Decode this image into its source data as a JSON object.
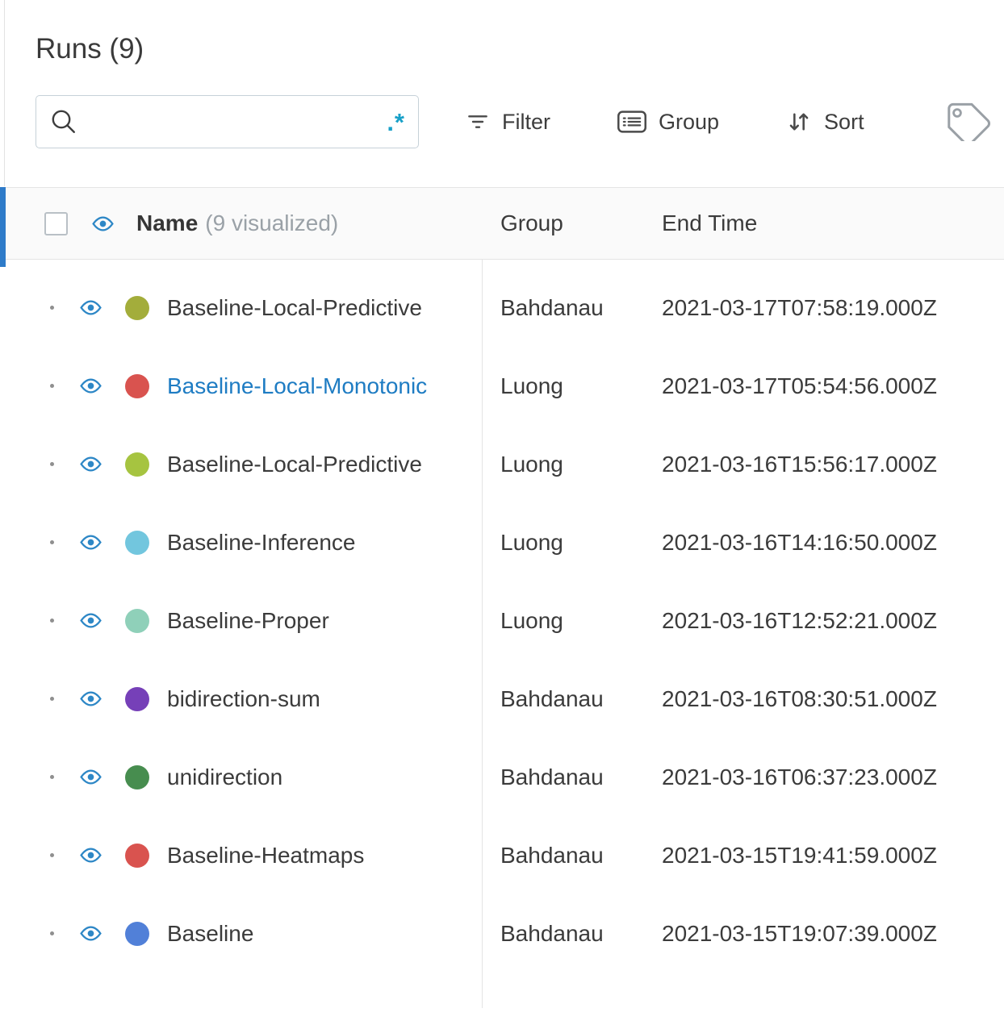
{
  "panel": {
    "title": "Runs (9)"
  },
  "search": {
    "placeholder": "",
    "value": "",
    "regex_label": ".*"
  },
  "toolbar": {
    "filter": "Filter",
    "group": "Group",
    "sort": "Sort"
  },
  "table": {
    "header": {
      "name_label": "Name",
      "name_sublabel": "(9 visualized)",
      "group_label": "Group",
      "end_time_label": "End Time"
    },
    "rows": [
      {
        "name": "Baseline-Local-Predictive",
        "color": "#a3ad3b",
        "group": "Bahdanau",
        "end_time": "2021-03-17T07:58:19.000Z",
        "highlighted": false
      },
      {
        "name": "Baseline-Local-Monotonic",
        "color": "#d9534f",
        "group": "Luong",
        "end_time": "2021-03-17T05:54:56.000Z",
        "highlighted": true
      },
      {
        "name": "Baseline-Local-Predictive",
        "color": "#a6c440",
        "group": "Luong",
        "end_time": "2021-03-16T15:56:17.000Z",
        "highlighted": false
      },
      {
        "name": "Baseline-Inference",
        "color": "#72c6de",
        "group": "Luong",
        "end_time": "2021-03-16T14:16:50.000Z",
        "highlighted": false
      },
      {
        "name": "Baseline-Proper",
        "color": "#8fd0b9",
        "group": "Luong",
        "end_time": "2021-03-16T12:52:21.000Z",
        "highlighted": false
      },
      {
        "name": "bidirection-sum",
        "color": "#7640b8",
        "group": "Bahdanau",
        "end_time": "2021-03-16T08:30:51.000Z",
        "highlighted": false
      },
      {
        "name": "unidirection",
        "color": "#478d4f",
        "group": "Bahdanau",
        "end_time": "2021-03-16T06:37:23.000Z",
        "highlighted": false
      },
      {
        "name": "Baseline-Heatmaps",
        "color": "#d9534f",
        "group": "Bahdanau",
        "end_time": "2021-03-15T19:41:59.000Z",
        "highlighted": false
      },
      {
        "name": "Baseline",
        "color": "#5180d8",
        "group": "Bahdanau",
        "end_time": "2021-03-15T19:07:39.000Z",
        "highlighted": false
      }
    ]
  },
  "colors": {
    "eye_icon": "#2d87c6",
    "highlighted_name": "#1e7cc3",
    "accent_strip": "#2e7bc9"
  }
}
